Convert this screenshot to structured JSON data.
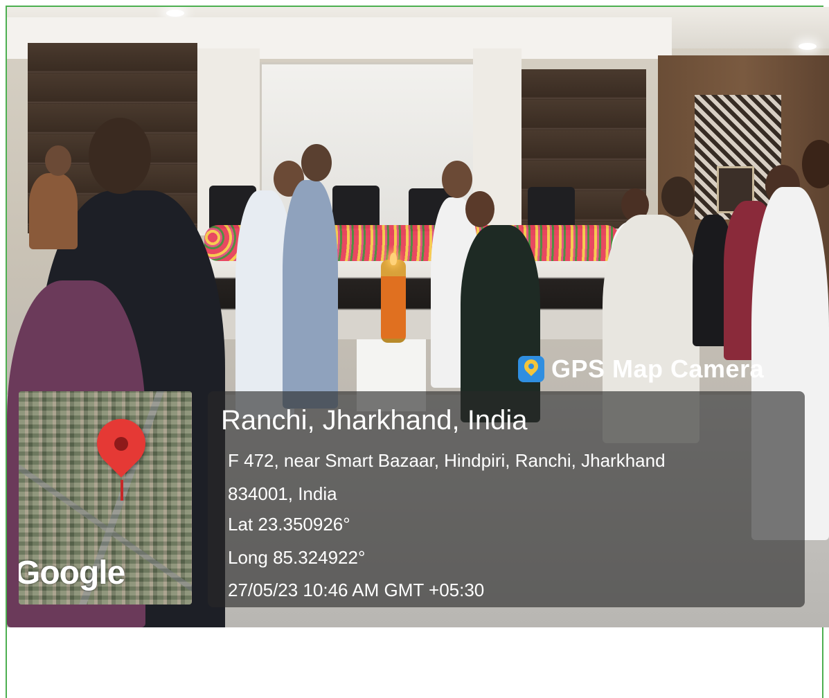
{
  "overlay": {
    "app_name": "GPS Map Camera",
    "app_icon": "gps-map-camera-icon",
    "location_title": "Ranchi, Jharkhand, India",
    "address_line1": "F 472, near Smart Bazaar, Hindpiri, Ranchi, Jharkhand",
    "address_line2": "834001, India",
    "latitude": "Lat 23.350926°",
    "longitude": "Long 85.324922°",
    "timestamp": "27/05/23 10:46 AM GMT +05:30",
    "map_watermark": "Google",
    "map_pin_icon": "map-pin-icon"
  },
  "colors": {
    "border": "#4caf50",
    "pin": "#e53935",
    "overlay_text": "#ffffff"
  }
}
